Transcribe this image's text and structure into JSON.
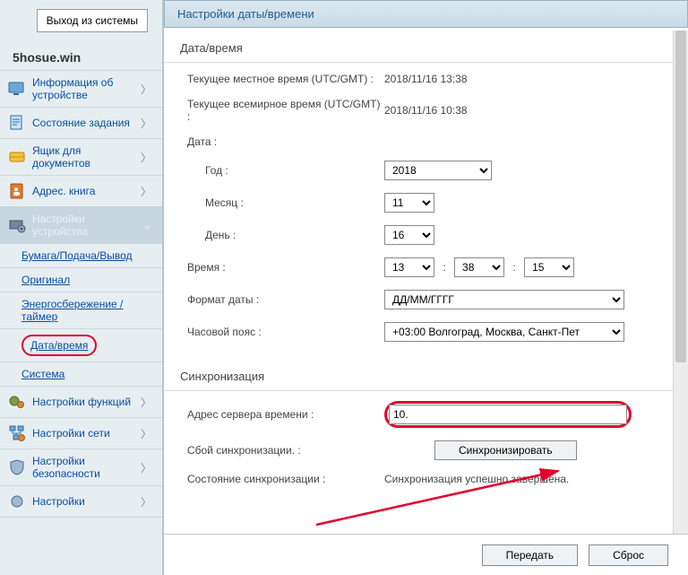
{
  "logout_label": "Выход из системы",
  "host": "5hosue.win",
  "sidebar": {
    "items": [
      {
        "label": "Информация об устройстве"
      },
      {
        "label": "Состояние задания"
      },
      {
        "label": "Ящик для документов"
      },
      {
        "label": "Адрес. книга"
      },
      {
        "label": "Настройки устройства"
      },
      {
        "label": "Настройки функций"
      },
      {
        "label": "Настройки сети"
      },
      {
        "label": "Настройки безопасности"
      },
      {
        "label": "Настройки"
      }
    ],
    "sub": [
      {
        "label": "Бумага/Подача/Вывод"
      },
      {
        "label": "Оригинал"
      },
      {
        "label": "Энергосбережение / таймер"
      },
      {
        "label": "Дата/время"
      },
      {
        "label": "Система"
      }
    ]
  },
  "panel": {
    "title": "Настройки даты/времени",
    "section1": "Дата/время",
    "local_label": "Текущее местное время (UTC/GMT) :",
    "local_value": "2018/11/16 13:38",
    "world_label": "Текущее всемирное время (UTC/GMT) :",
    "world_value": "2018/11/16 10:38",
    "date_label": "Дата :",
    "year_label": "Год :",
    "year_value": "2018",
    "month_label": "Месяц :",
    "month_value": "11",
    "day_label": "День :",
    "day_value": "16",
    "time_label": "Время :",
    "time_h": "13",
    "time_m": "38",
    "time_s": "15",
    "fmt_label": "Формат даты :",
    "fmt_value": "ДД/ММ/ГГГГ",
    "tz_label": "Часовой пояс :",
    "tz_value": "+03:00 Волгоград, Москва, Санкт-Пет",
    "section2": "Синхронизация",
    "server_label": "Адрес сервера времени :",
    "server_value": "10.",
    "fail_label": "Сбой синхронизации. :",
    "sync_btn": "Синхронизировать",
    "state_label": "Состояние синхронизации :",
    "state_value": "Синхронизация успешно завершена.",
    "submit": "Передать",
    "reset": "Сброс"
  }
}
